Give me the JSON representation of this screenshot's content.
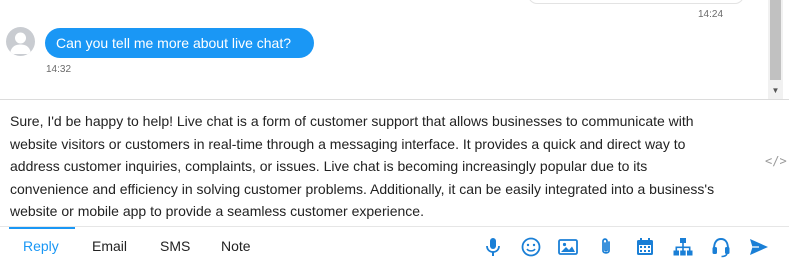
{
  "history": {
    "previous_message_time": "14:24",
    "message": {
      "text": "Can you tell me more about live chat?",
      "time": "14:32"
    }
  },
  "composer": {
    "lines": [
      "Sure, I'd be happy to help! Live chat is a form of customer support that allows businesses to communicate with",
      "website visitors or customers in real-time through a messaging interface. It provides a quick and direct way to",
      "address customer inquiries, complaints, or issues. Live chat is becoming increasingly popular due to its",
      "convenience and efficiency in solving customer problems. Additionally, it can be easily integrated into a business's",
      "website or mobile app to provide a seamless customer experience."
    ],
    "code_icon": "</>"
  },
  "tabs": [
    {
      "label": "Reply",
      "active": true
    },
    {
      "label": "Email",
      "active": false
    },
    {
      "label": "SMS",
      "active": false
    },
    {
      "label": "Note",
      "active": false
    }
  ],
  "toolbar_icons": [
    "microphone-icon",
    "emoji-icon",
    "image-icon",
    "attachment-icon",
    "calendar-icon",
    "sitemap-icon",
    "headset-icon",
    "send-icon"
  ],
  "colors": {
    "accent": "#1a97f5",
    "bubble_text": "#ffffff",
    "icon_blue": "#1a7fd6",
    "avatar_bg": "#c9ccd1"
  }
}
